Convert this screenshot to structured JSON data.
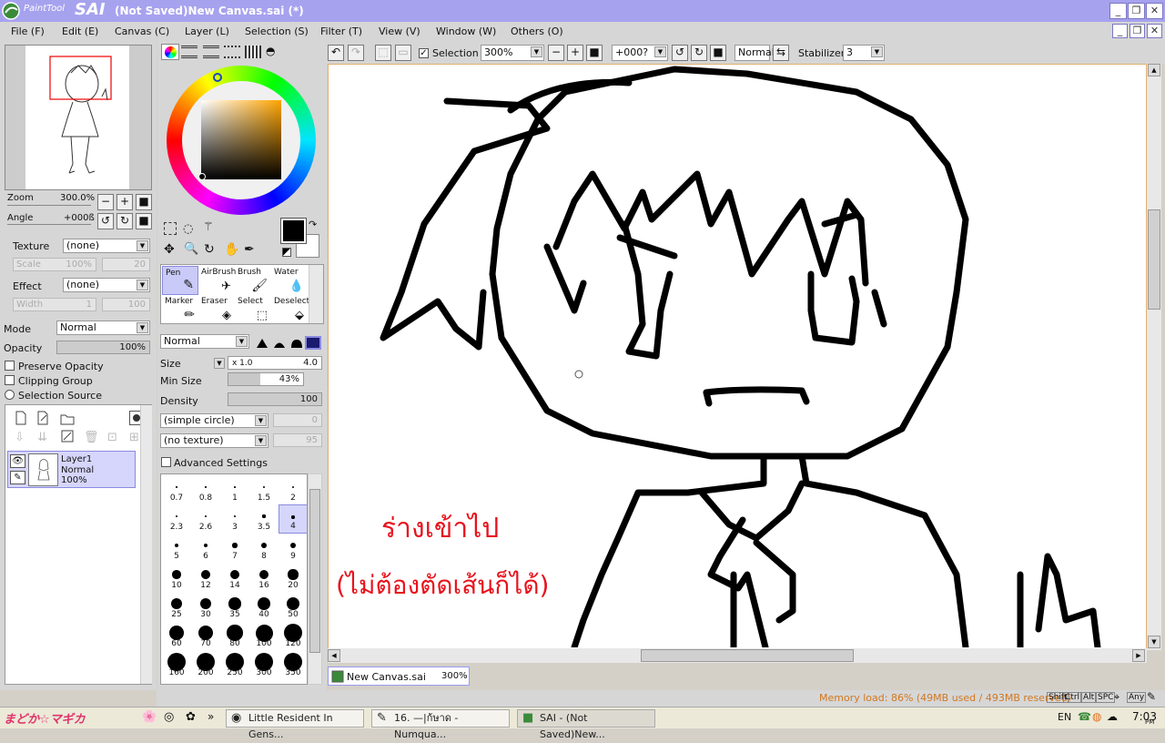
{
  "window": {
    "logo_small": "PaintTool",
    "logo_big": "SAI",
    "title": "(Not Saved)New Canvas.sai (*)"
  },
  "menu": [
    "File (F)",
    "Edit (E)",
    "Canvas (C)",
    "Layer (L)",
    "Selection (S)",
    "Filter (T)",
    "View (V)",
    "Window (W)",
    "Others (O)"
  ],
  "navigator": {
    "zoom_label": "Zoom",
    "zoom_value": "300.0%",
    "angle_label": "Angle",
    "angle_value": "+000ß"
  },
  "props": {
    "texture_label": "Texture",
    "texture_value": "(none)",
    "scale_label": "Scale",
    "scale_value": "100%",
    "scale_num": "20",
    "effect_label": "Effect",
    "effect_value": "(none)",
    "width_label": "Width",
    "width_value": "1",
    "width_num": "100",
    "mode_label": "Mode",
    "mode_value": "Normal",
    "opacity_label": "Opacity",
    "opacity_value": "100%",
    "preserve_opacity": "Preserve Opacity",
    "clipping_group": "Clipping Group",
    "selection_source": "Selection Source"
  },
  "layer": {
    "name": "Layer1",
    "mode": "Normal",
    "opacity": "100%"
  },
  "tools": [
    {
      "label": "Pen"
    },
    {
      "label": "AirBrush"
    },
    {
      "label": "Brush"
    },
    {
      "label": "Water"
    },
    {
      "label": "Marker"
    },
    {
      "label": "Eraser"
    },
    {
      "label": "Select"
    },
    {
      "label": "Deselect"
    }
  ],
  "brush": {
    "blend_mode": "Normal",
    "size_label": "Size",
    "size_mult": "x 1.0",
    "size_value": "4.0",
    "min_size_label": "Min Size",
    "min_size_value": "43%",
    "min_size_fraction": 0.43,
    "density_label": "Density",
    "density_value": "100",
    "shape": "(simple circle)",
    "shape_num": "0",
    "texture": "(no texture)",
    "texture_num": "95",
    "advanced": "Advanced Settings"
  },
  "brush_sizes": [
    "0.7",
    "0.8",
    "1",
    "1.5",
    "2",
    "2.3",
    "2.6",
    "3",
    "3.5",
    "4",
    "5",
    "6",
    "7",
    "8",
    "9",
    "10",
    "12",
    "14",
    "16",
    "20",
    "25",
    "30",
    "35",
    "40",
    "50",
    "60",
    "70",
    "80",
    "100",
    "120",
    "160",
    "200",
    "250",
    "300",
    "350"
  ],
  "toolbar": {
    "selection_label": "Selection",
    "zoom": "300%",
    "angle": "+000?",
    "blend": "Normal",
    "stabilizer_label": "Stabilizer",
    "stabilizer_value": "3"
  },
  "canvas": {
    "annotation_line1": "ร่างเข้าไป",
    "annotation_line2": "(ไม่ต้องตัดเส้นก็ได้)",
    "annotation_color": "#e8121c"
  },
  "canvas_tab": {
    "name": "New Canvas.sai",
    "zoom": "300%"
  },
  "status": {
    "memory": "Memory load: 86% (49MB used / 493MB reserved)",
    "memory_color": "#d2781e",
    "keys": [
      "Shift",
      "Ctrl",
      "Alt",
      "SPC",
      "Any"
    ]
  },
  "taskbar": {
    "logo_text": "まどか☆マギカ",
    "tasks": [
      "Little Resident In Gens...",
      "16. —|ก้ษาด - Numqua...",
      "SAI - (Not Saved)New..."
    ],
    "lang": "EN",
    "clock": "7:03",
    "ampm": "PM"
  }
}
